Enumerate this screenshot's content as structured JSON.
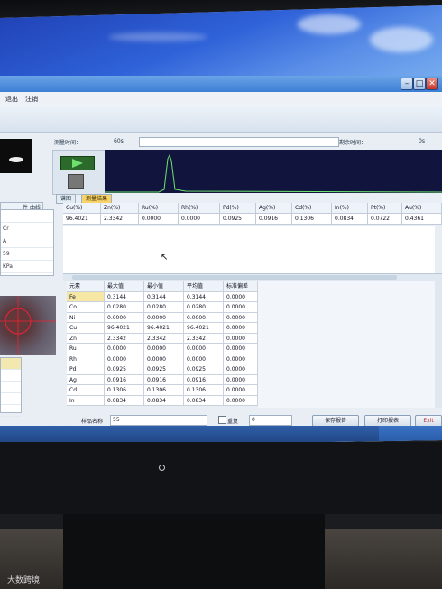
{
  "menu": {
    "items": [
      "退出",
      "注销"
    ]
  },
  "timebar": {
    "measure_time_label": "测量时间：",
    "measure_time_value": "60s",
    "remaining_time_label": "剩余时间：",
    "remaining_time_value": "0s"
  },
  "left_panel": {
    "tab_label": "件 曲线",
    "list_items": [
      "",
      "Cr",
      "A",
      "59",
      "KPa"
    ]
  },
  "tabs": [
    "谱图",
    "测量结果"
  ],
  "results": {
    "headers": [
      "Cu(%)",
      "Zn(%)",
      "Ru(%)",
      "Rh(%)",
      "Pd(%)",
      "Ag(%)",
      "Cd(%)",
      "In(%)",
      "Pt(%)",
      "Au(%)"
    ],
    "values": [
      "96.4021",
      "2.3342",
      "0.0000",
      "0.0000",
      "0.0925",
      "0.0916",
      "0.1306",
      "0.0834",
      "0.0722",
      "0.4361"
    ]
  },
  "stats": {
    "headers": [
      "元素",
      "最大值",
      "最小值",
      "平均值",
      "标准偏差"
    ],
    "rows": [
      [
        "Fe",
        "0.3144",
        "0.3144",
        "0.3144",
        "0.0000"
      ],
      [
        "Co",
        "0.0280",
        "0.0280",
        "0.0280",
        "0.0000"
      ],
      [
        "Ni",
        "0.0000",
        "0.0000",
        "0.0000",
        "0.0000"
      ],
      [
        "Cu",
        "96.4021",
        "96.4021",
        "96.4021",
        "0.0000"
      ],
      [
        "Zn",
        "2.3342",
        "2.3342",
        "2.3342",
        "0.0000"
      ],
      [
        "Ru",
        "0.0000",
        "0.0000",
        "0.0000",
        "0.0000"
      ],
      [
        "Rh",
        "0.0000",
        "0.0000",
        "0.0000",
        "0.0000"
      ],
      [
        "Pd",
        "0.0925",
        "0.0925",
        "0.0925",
        "0.0000"
      ],
      [
        "Ag",
        "0.0916",
        "0.0916",
        "0.0916",
        "0.0000"
      ],
      [
        "Cd",
        "0.1306",
        "0.1306",
        "0.1306",
        "0.0000"
      ],
      [
        "In",
        "0.0834",
        "0.0834",
        "0.0834",
        "0.0000"
      ]
    ]
  },
  "bottom": {
    "sample_name_label": "样品名称",
    "sample_name_value": "55",
    "repeat_label": "重复",
    "repeat_value": "0",
    "save_report": "保存报告",
    "print_report": "打印报表",
    "exit": "Exit"
  },
  "watermark": "大数跨境",
  "colors": {
    "sky": "#2f62d8",
    "selected_tab": "#f7d36a",
    "spectrum_bg": "#11153d",
    "play_green": "#6ee06e"
  }
}
